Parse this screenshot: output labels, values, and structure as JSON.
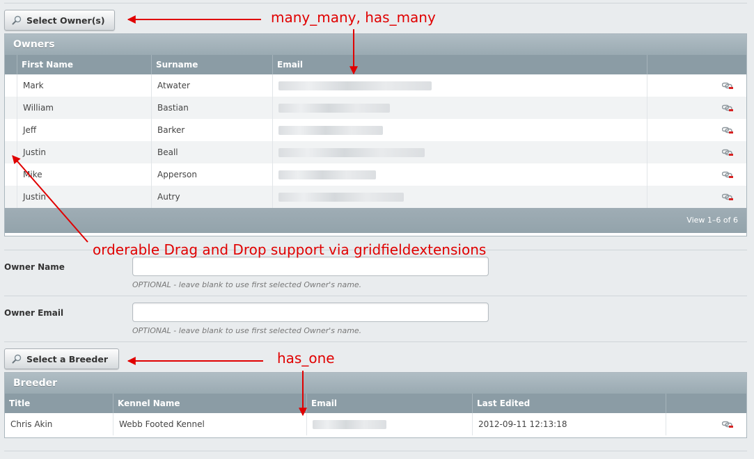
{
  "owners_button": {
    "label": "Select Owner(s)",
    "icon": "magnifier-icon"
  },
  "owners_grid": {
    "title": "Owners",
    "columns": [
      "First Name",
      "Surname",
      "Email"
    ],
    "rows": [
      {
        "first_name": "Mark",
        "surname": "Atwater"
      },
      {
        "first_name": "William",
        "surname": "Bastian"
      },
      {
        "first_name": "Jeff",
        "surname": "Barker"
      },
      {
        "first_name": "Justin",
        "surname": "Beall"
      },
      {
        "first_name": "Mike",
        "surname": "Apperson"
      },
      {
        "first_name": "Justin",
        "surname": "Autry"
      }
    ],
    "footer": "View 1–6 of 6",
    "row_action_icon": "unlink-icon"
  },
  "owner_name": {
    "label": "Owner Name",
    "value": "",
    "hint": "OPTIONAL - leave blank to use first selected Owner's name."
  },
  "owner_email": {
    "label": "Owner Email",
    "value": "",
    "hint": "OPTIONAL - leave blank to use first selected Owner's name."
  },
  "breeder_button": {
    "label": "Select a Breeder",
    "icon": "magnifier-icon"
  },
  "breeder_grid": {
    "title": "Breeder",
    "columns": [
      "Title",
      "Kennel Name",
      "Email",
      "Last Edited"
    ],
    "rows": [
      {
        "title": "Chris Akin",
        "kennel_name": "Webb Footed Kennel",
        "last_edited": "2012-09-11 12:13:18"
      }
    ],
    "row_action_icon": "unlink-icon"
  },
  "annotations": {
    "many_many": "many_many, has_many",
    "orderable": "orderable Drag and Drop support via gridfieldextensions",
    "has_one": "has_one"
  },
  "colors": {
    "annotation": "#e00000",
    "grid_header": "#8b9ca5",
    "grid_title": "#a4b3ba"
  }
}
